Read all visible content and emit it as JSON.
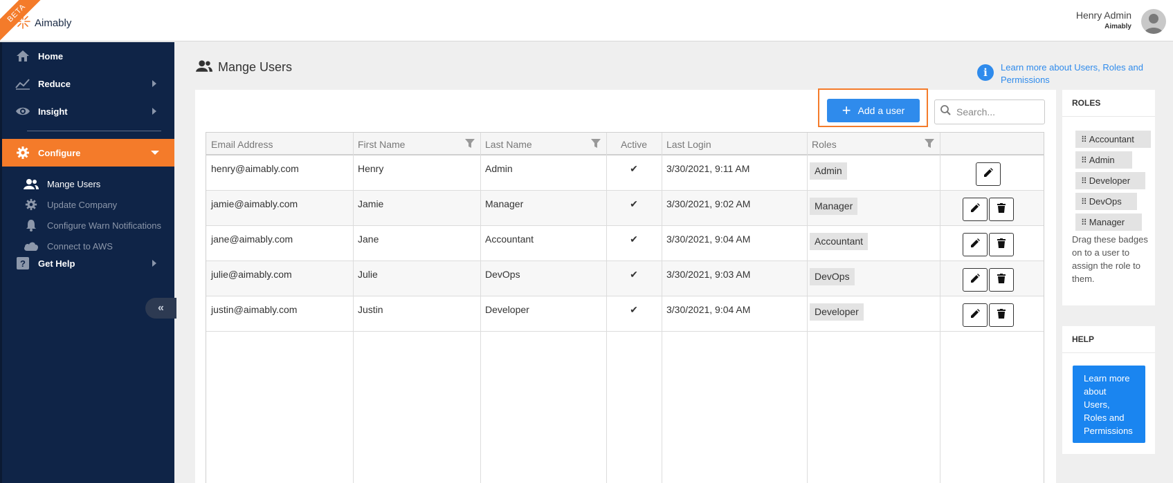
{
  "app": {
    "beta_label": "BETA",
    "logo_text": "Aimably",
    "user_name": "Henry Admin",
    "user_org": "Aimably",
    "accent_color": "#f47b2a",
    "sidebar_color": "#0f2447",
    "primary_color": "#2f8bec"
  },
  "sidebar": {
    "items": [
      {
        "label": "Home",
        "icon": "home-icon"
      },
      {
        "label": "Reduce",
        "icon": "chart-trend-icon"
      },
      {
        "label": "Insight",
        "icon": "eye-icon"
      },
      {
        "label": "Configure",
        "icon": "gear-icon"
      },
      {
        "label": "Get Help",
        "icon": "help-icon"
      }
    ],
    "sub_items": [
      {
        "label": "Mange Users",
        "icon": "users-icon"
      },
      {
        "label": "Update Company",
        "icon": "gear-icon"
      },
      {
        "label": "Configure Warn Notifications",
        "icon": "bell-icon"
      },
      {
        "label": "Connect to AWS",
        "icon": "cloud-icon"
      }
    ],
    "collapse_glyph": "«"
  },
  "main": {
    "title": "Mange Users",
    "help_link": "Learn more about Users, Roles and Permissions",
    "add_button": "Add a user",
    "search_placeholder": "Search...",
    "columns": [
      "Email Address",
      "First Name",
      "Last Name",
      "Active",
      "Last Login",
      "Roles"
    ],
    "rows": [
      {
        "email": "henry@aimably.com",
        "first": "Henry",
        "last": "Admin",
        "active": "✔",
        "login": "3/30/2021, 9:11 AM",
        "role": "Admin",
        "deletable": false
      },
      {
        "email": "jamie@aimably.com",
        "first": "Jamie",
        "last": "Manager",
        "active": "✔",
        "login": "3/30/2021, 9:02 AM",
        "role": "Manager",
        "deletable": true
      },
      {
        "email": "jane@aimably.com",
        "first": "Jane",
        "last": "Accountant",
        "active": "✔",
        "login": "3/30/2021, 9:04 AM",
        "role": "Accountant",
        "deletable": true
      },
      {
        "email": "julie@aimably.com",
        "first": "Julie",
        "last": "DevOps",
        "active": "✔",
        "login": "3/30/2021, 9:03 AM",
        "role": "DevOps",
        "deletable": true
      },
      {
        "email": "justin@aimably.com",
        "first": "Justin",
        "last": "Developer",
        "active": "✔",
        "login": "3/30/2021, 9:04 AM",
        "role": "Developer",
        "deletable": true
      }
    ]
  },
  "roles_panel": {
    "title": "ROLES",
    "grip": "⠿",
    "roles": [
      "Accountant",
      "Admin",
      "Developer",
      "DevOps",
      "Manager"
    ],
    "hint": "Drag these badges on to a user to assign the role to them."
  },
  "help_panel": {
    "title": "HELP",
    "button": "Learn more about Users, Roles and Permissions"
  }
}
